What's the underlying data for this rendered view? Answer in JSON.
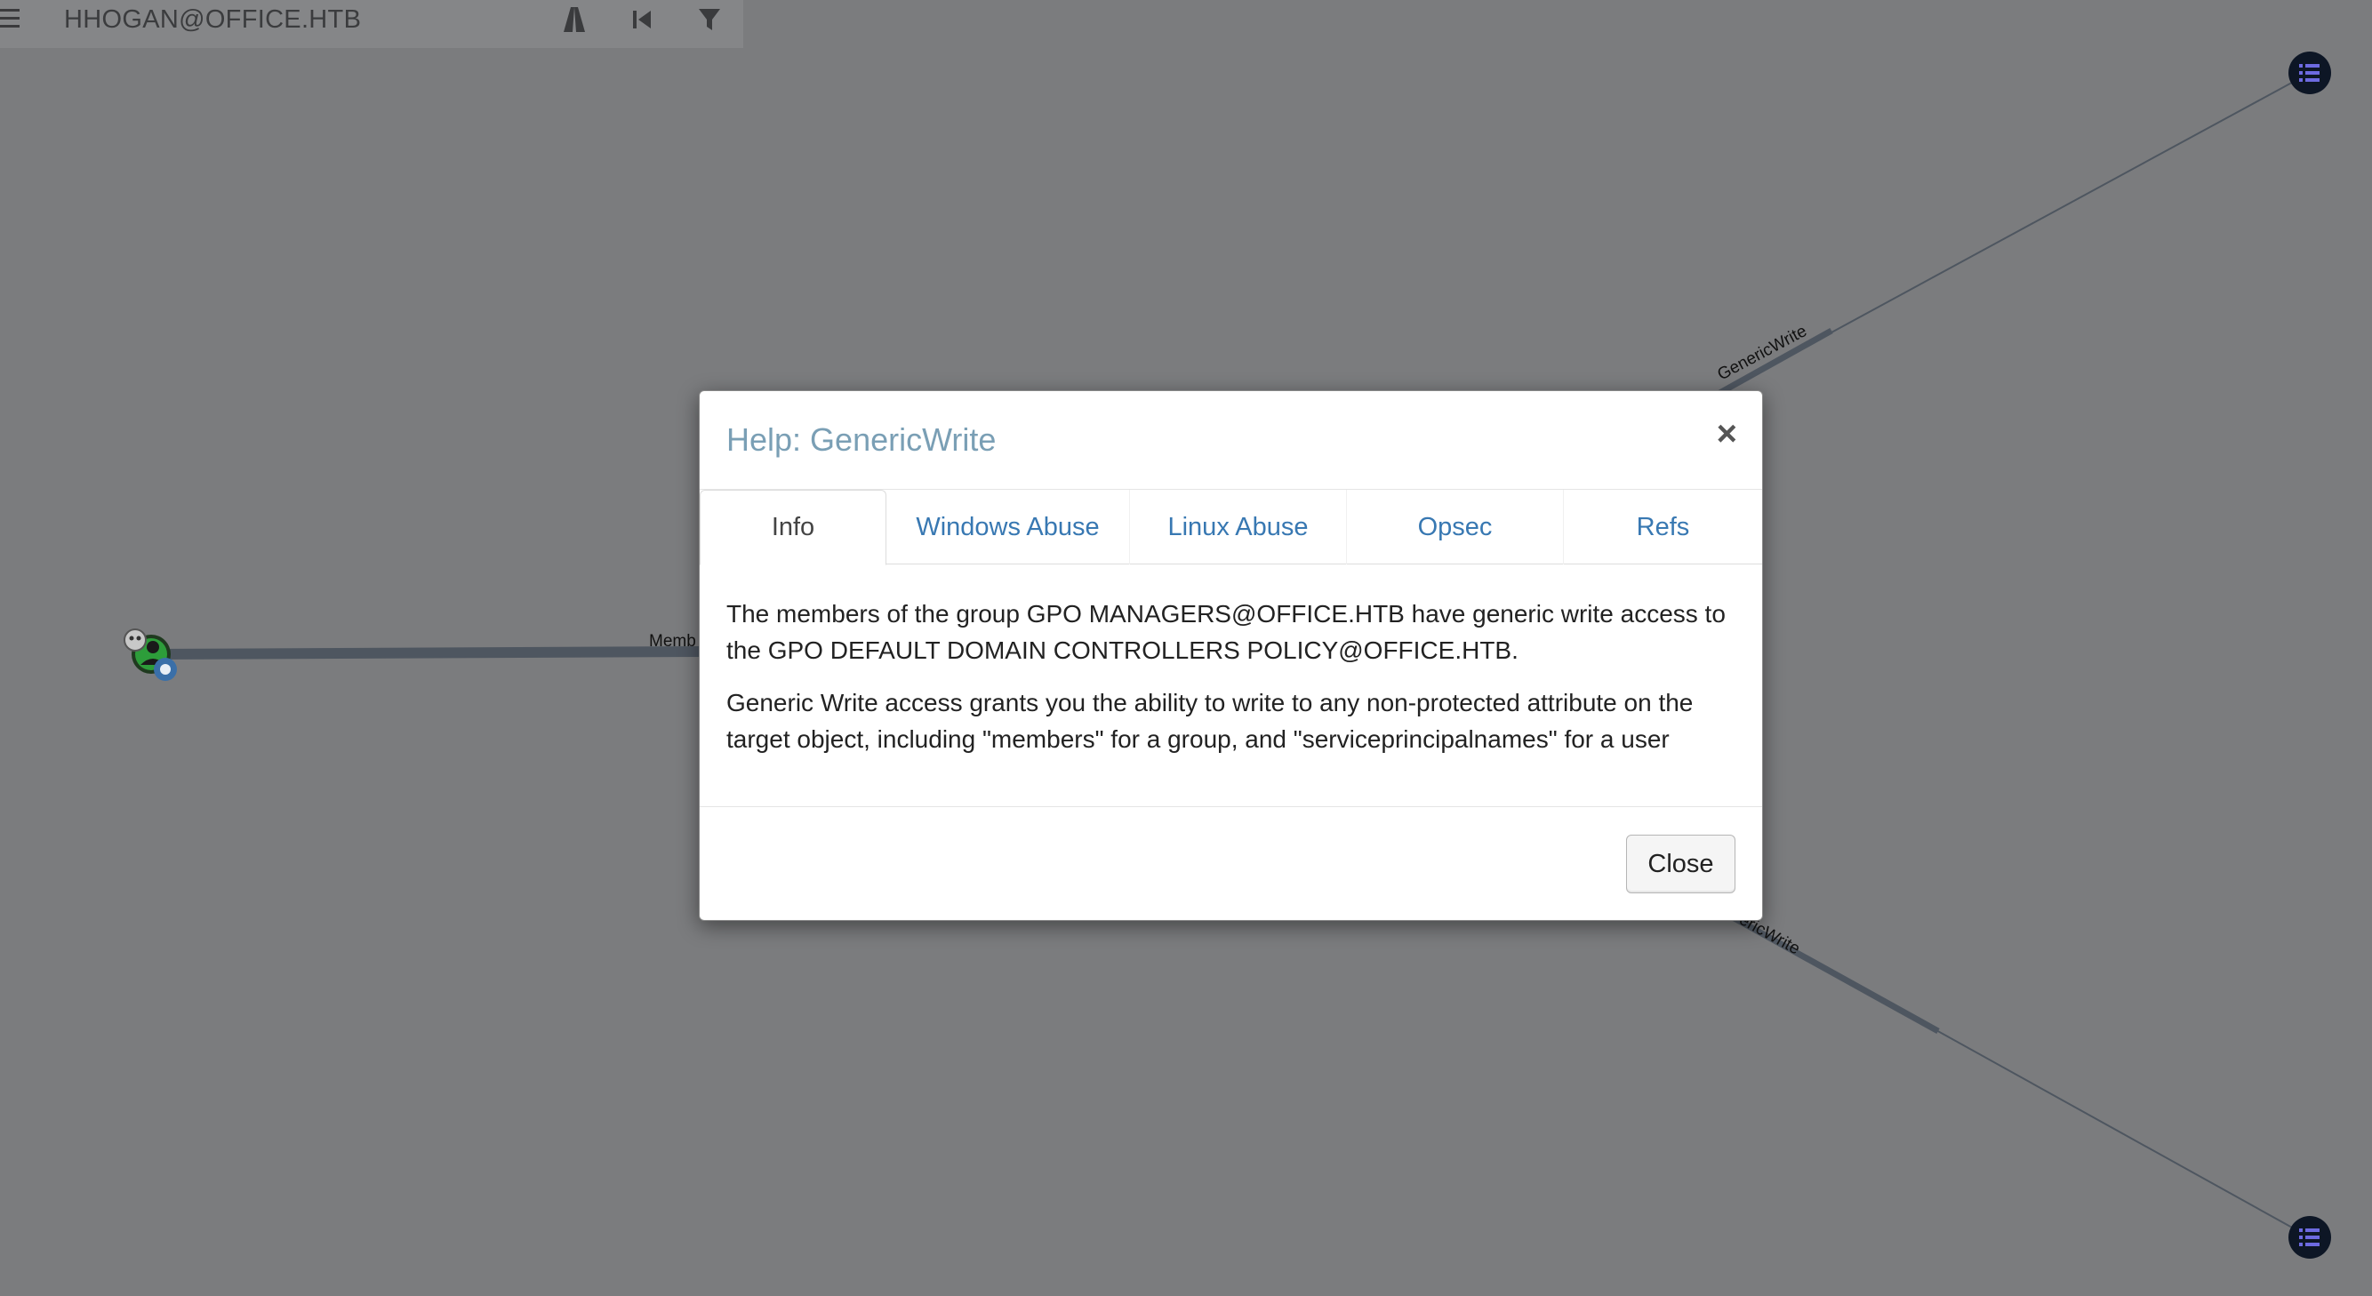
{
  "search": {
    "value": "HHOGAN@OFFICE.HTB"
  },
  "toolbar": {
    "icons": [
      "menu-icon",
      "pathfinding-icon",
      "back-icon",
      "filter-icon"
    ]
  },
  "graph": {
    "edge_labels": {
      "left_edge": "Memb",
      "top_edge": "GenericWrite",
      "bottom_edge": "ericWrite"
    },
    "colors": {
      "background": "#7b7c7e",
      "edge": "#4e5660",
      "node_dark": "#0d1625",
      "node_accent": "#5b58c9"
    }
  },
  "modal": {
    "title": "Help: GenericWrite",
    "tabs": [
      {
        "label": "Info",
        "active": true
      },
      {
        "label": "Windows Abuse",
        "active": false
      },
      {
        "label": "Linux Abuse",
        "active": false
      },
      {
        "label": "Opsec",
        "active": false
      },
      {
        "label": "Refs",
        "active": false
      }
    ],
    "body": {
      "paragraph1": "The members of the group GPO MANAGERS@OFFICE.HTB have generic write access to the GPO DEFAULT DOMAIN CONTROLLERS POLICY@OFFICE.HTB.",
      "paragraph2": "Generic Write access grants you the ability to write to any non-protected attribute on the target object, including \"members\" for a group, and \"serviceprincipalnames\" for a user"
    },
    "close_button": "Close",
    "close_x": "×"
  }
}
